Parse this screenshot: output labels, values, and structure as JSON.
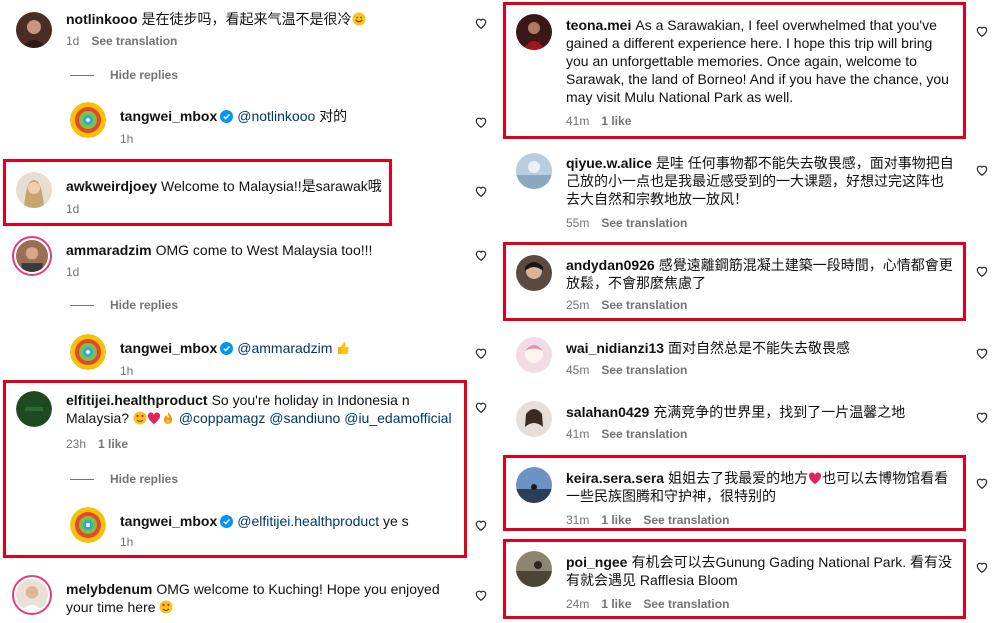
{
  "left": {
    "c1": {
      "user": "notlinkooo",
      "text": "是在徒步吗，看起来气温不是很冷",
      "time": "1d",
      "see": "See translation"
    },
    "hide1": "Hide replies",
    "r1": {
      "user": "tangwei_mbox",
      "mention": "@notlinkooo",
      "text": "对的",
      "time": "1h"
    },
    "c2": {
      "user": "awkweirdjoey",
      "text": "Welcome to Malaysia!!是sarawak哦",
      "time": "1d"
    },
    "c3": {
      "user": "ammaradzim",
      "text": "OMG come to West Malaysia too!!!",
      "time": "1d"
    },
    "hide2": "Hide replies",
    "r2": {
      "user": "tangwei_mbox",
      "mention": "@ammaradzim",
      "time": "1h"
    },
    "c4": {
      "user": "elfitijei.healthproduct",
      "text1": "So you're holiday in Indonesia n",
      "text2": "Malaysia?",
      "m1": "@coppamagz",
      "m2": "@sandiuno",
      "m3": "@iu_edamofficial",
      "time": "23h",
      "likes": "1 like"
    },
    "hide3": "Hide replies",
    "r3": {
      "user": "tangwei_mbox",
      "mention": "@elfitijei.healthproduct",
      "text": "ye s",
      "time": "1h"
    },
    "c5": {
      "user": "melybdenum",
      "text1": "OMG welcome to Kuching! Hope you enjoyed",
      "text2": "your time here"
    }
  },
  "right": {
    "c1": {
      "user": "teona.mei",
      "text1": "As a Sarawakian, I feel overwhelmed that you've",
      "text2": "gained a different experience here. I hope this trip will bring",
      "text3": "you an unforgettable memories. Once again, welcome to",
      "text4": "Sarawak, the land of Borneo! And if you have the chance, you",
      "text5": "may visit Mulu National Park as well.",
      "time": "41m",
      "likes": "1 like"
    },
    "c2": {
      "user": "qiyue.w.alice",
      "text1": "是哇 任何事物都不能失去敬畏感，面对事物把自",
      "text2": "己放的小一点也是我最近感受到的一大课题，好想过完这阵也",
      "text3": "去大自然和宗教地放一放风！",
      "time": "55m",
      "see": "See translation"
    },
    "c3": {
      "user": "andydan0926",
      "text1": "感覺遠離鋼筋混凝土建築一段時間，心情都會更",
      "text2": "放鬆，不會那麼焦慮了",
      "time": "25m",
      "see": "See translation"
    },
    "c4": {
      "user": "wai_nidianzi13",
      "text": "面对自然总是不能失去敬畏感",
      "time": "45m",
      "see": "See translation"
    },
    "c5": {
      "user": "salahan0429",
      "text": "充满竞争的世界里，找到了一片温馨之地",
      "time": "41m",
      "see": "See translation"
    },
    "c6": {
      "user": "keira.sera.sera",
      "text1a": "姐姐去了我最爱的地方",
      "text1b": "也可以去博物馆看看",
      "text2": "一些民族图腾和守护神，很特别的",
      "time": "31m",
      "likes": "1 like",
      "see": "See translation"
    },
    "c7": {
      "user": "poi_ngee",
      "text1": "有机会可以去Gunung Gading National Park. 看有没",
      "text2": "有就会遇见 Rafflesia Bloom",
      "time": "24m",
      "likes": "1 like",
      "see": "See translation"
    }
  },
  "colors": {
    "highlight": "#e0001b",
    "mention": "#00376b",
    "meta": "#737373",
    "verified": "#0095f6"
  }
}
